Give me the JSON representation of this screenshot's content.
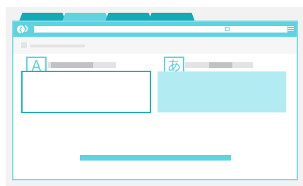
{
  "tabs": [
    {
      "label": "",
      "active": false
    },
    {
      "label": "",
      "active": true
    },
    {
      "label": "",
      "active": false
    },
    {
      "label": "",
      "active": false
    }
  ],
  "toolbar": {
    "back_glyph": "❮",
    "forward_glyph": "❯",
    "address": "",
    "go_glyph": "→",
    "search_placeholder": ""
  },
  "panels": {
    "left": {
      "badge": "A",
      "label": ""
    },
    "right": {
      "badge": "あ",
      "label": ""
    }
  },
  "icons": [
    "back-icon",
    "forward-icon",
    "go-arrow-icon",
    "search-icon",
    "menu-icon"
  ],
  "colors": {
    "accent": "#5fd3df",
    "tab": "#14a9b4",
    "panel_fill": "#b2ebf2",
    "placeholder": "#e3e3e3"
  }
}
